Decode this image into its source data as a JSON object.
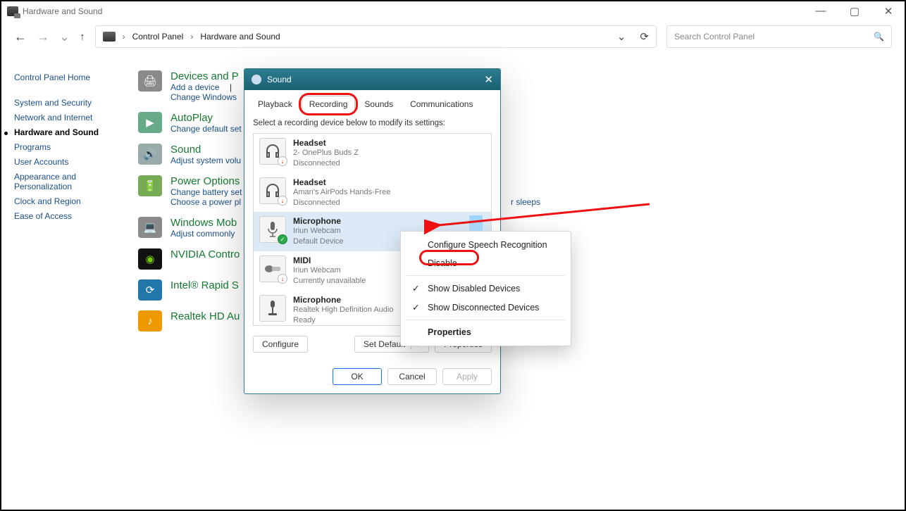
{
  "window": {
    "title": "Hardware and Sound",
    "min": "—",
    "max": "▢",
    "close": "✕"
  },
  "breadcrumb": {
    "a": "Control Panel",
    "b": "Hardware and Sound"
  },
  "search": {
    "placeholder": "Search Control Panel"
  },
  "sidebar": {
    "home": "Control Panel Home",
    "items": [
      "System and Security",
      "Network and Internet",
      "Hardware and Sound",
      "Programs",
      "User Accounts",
      "Appearance and Personalization",
      "Clock and Region",
      "Ease of Access"
    ]
  },
  "cats": [
    {
      "title": "Devices and P",
      "links": [
        "Add a device"
      ],
      "partial": "Change Windows"
    },
    {
      "title": "AutoPlay",
      "links": [],
      "partial": "Change default set"
    },
    {
      "title": "Sound",
      "links": [],
      "partial": "Adjust system volu"
    },
    {
      "title": "Power Options",
      "links": [
        "Change battery set"
      ],
      "partial": "Choose a power pl"
    },
    {
      "title": "Windows Mob",
      "links": [],
      "partial": "Adjust commonly"
    },
    {
      "title": "NVIDIA Contro",
      "links": [],
      "partial": ""
    },
    {
      "title": "Intel® Rapid S",
      "links": [],
      "partial": ""
    },
    {
      "title": "Realtek HD Au",
      "links": [],
      "partial": ""
    }
  ],
  "sleeps": "r sleeps",
  "dialog": {
    "title": "Sound",
    "tabs": [
      "Playback",
      "Recording",
      "Sounds",
      "Communications"
    ],
    "instruction": "Select a recording device below to modify its settings:",
    "devices": [
      {
        "name": "Headset",
        "sub1": "2- OnePlus Buds Z",
        "sub2": "Disconnected",
        "badge": "down"
      },
      {
        "name": "Headset",
        "sub1": "Aman's AirPods Hands-Free",
        "sub2": "Disconnected",
        "badge": "down"
      },
      {
        "name": "Microphone",
        "sub1": "Iriun Webcam",
        "sub2": "Default Device",
        "badge": "green",
        "selected": true
      },
      {
        "name": "MIDI",
        "sub1": "Iriun Webcam",
        "sub2": "Currently unavailable",
        "badge": "down"
      },
      {
        "name": "Microphone",
        "sub1": "Realtek High Definition Audio",
        "sub2": "Ready",
        "badge": "none"
      }
    ],
    "btns": {
      "configure": "Configure",
      "setdefault": "Set Default",
      "properties": "Properties",
      "ok": "OK",
      "cancel": "Cancel",
      "apply": "Apply"
    }
  },
  "ctx": {
    "items": [
      {
        "label": "Configure Speech Recognition"
      },
      {
        "label": "Disable",
        "highlight": true
      },
      {
        "sep": true
      },
      {
        "label": "Show Disabled Devices",
        "check": true
      },
      {
        "label": "Show Disconnected Devices",
        "check": true
      },
      {
        "sep": true
      },
      {
        "label": "Properties",
        "bold": true
      }
    ]
  }
}
